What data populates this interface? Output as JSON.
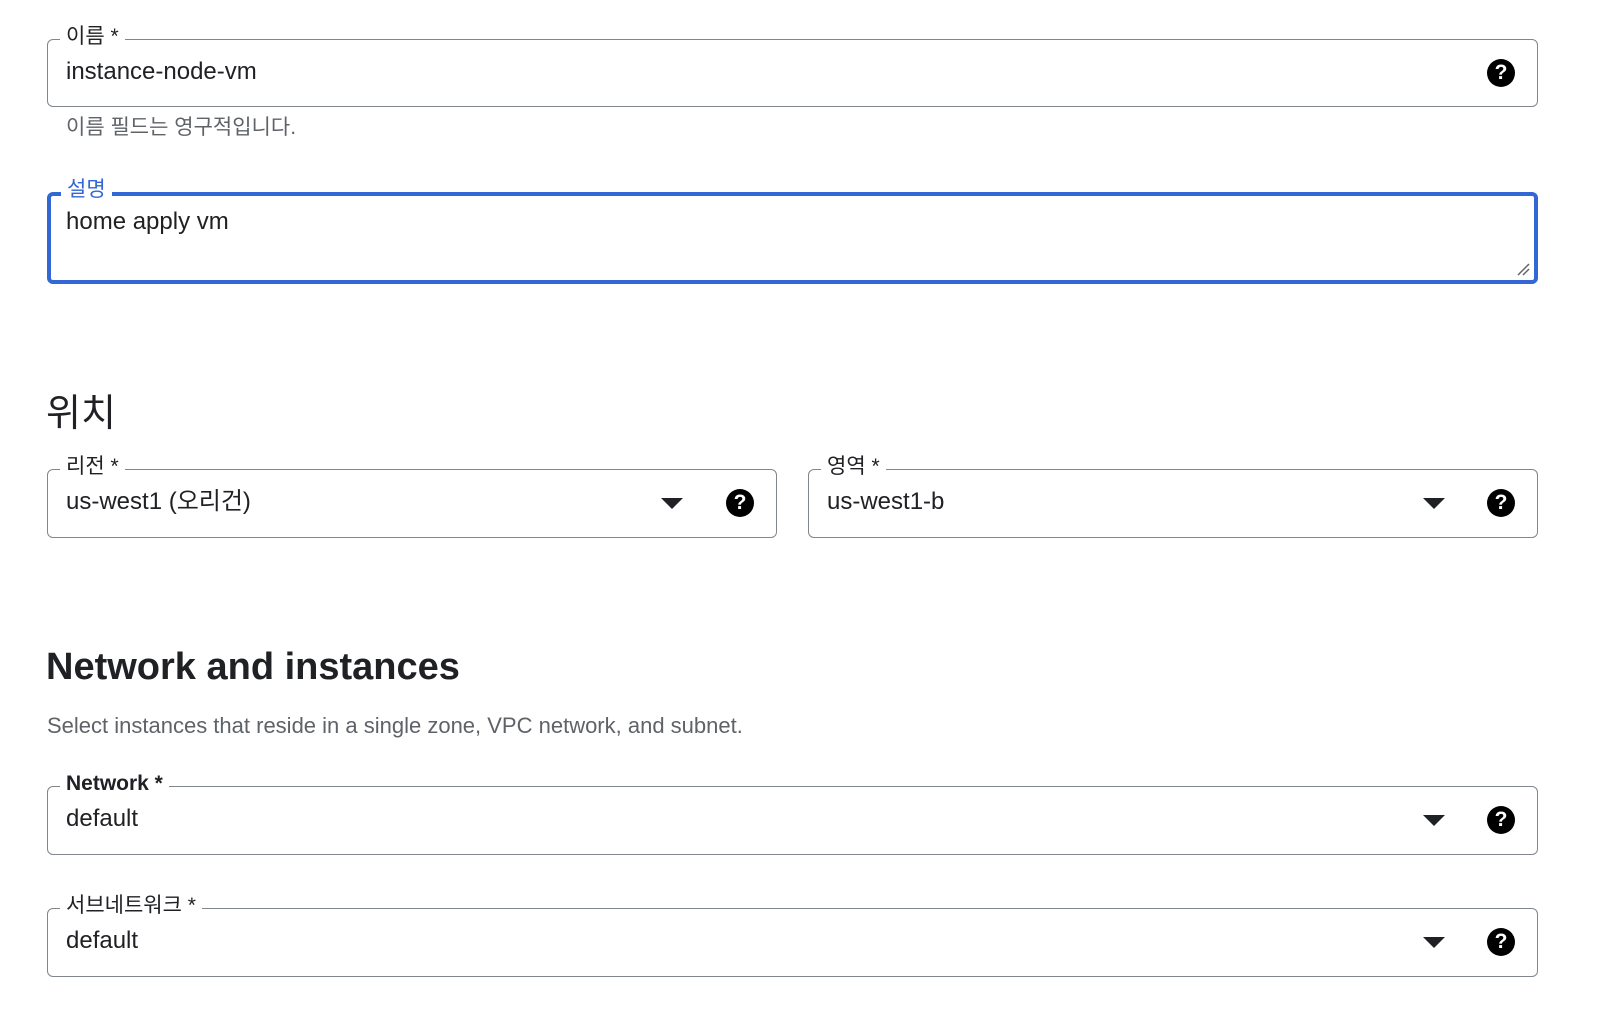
{
  "name_field": {
    "label": "이름 *",
    "value": "instance-node-vm",
    "hint": "이름 필드는 영구적입니다."
  },
  "description_field": {
    "label": "설명",
    "value": "home apply vm"
  },
  "location_section": {
    "title": "위치",
    "region": {
      "label": "리전 *",
      "value": "us-west1 (오리건)"
    },
    "zone": {
      "label": "영역 *",
      "value": "us-west1-b"
    }
  },
  "network_section": {
    "title": "Network and instances",
    "description": "Select instances that reside in a single zone, VPC network, and subnet.",
    "network": {
      "label": "Network *",
      "value": "default"
    },
    "subnetwork": {
      "label": "서브네트워크 *",
      "value": "default"
    }
  },
  "icons": {
    "help": "help-icon",
    "dropdown": "arrow-drop-down-icon",
    "help_glyph": "?"
  },
  "colors": {
    "focus_accent": "#3367d6",
    "border": "#80868b",
    "hint_text": "#5f6368"
  }
}
